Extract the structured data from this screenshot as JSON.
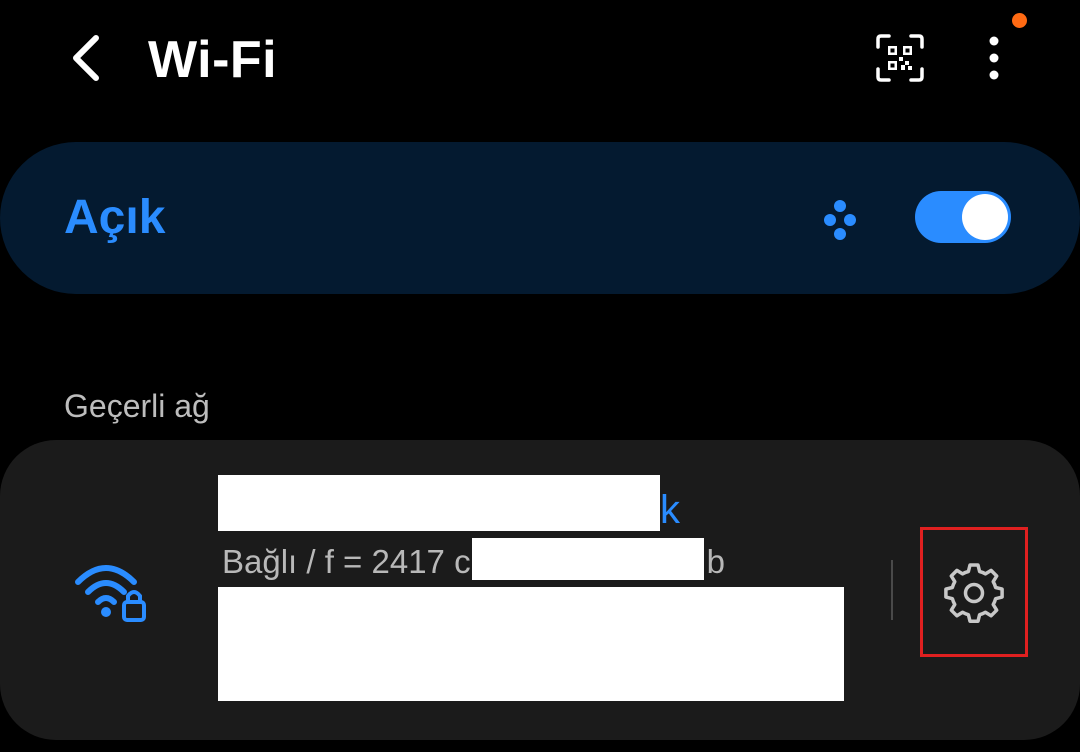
{
  "header": {
    "title": "Wi-Fi",
    "back_icon": "chevron-left-icon",
    "qr_icon": "qr-code-scan-icon",
    "more_icon": "more-vertical-icon",
    "notification_dot_color": "#ff6a13"
  },
  "toggle": {
    "label": "Açık",
    "state": true,
    "accent_color": "#2a8cff",
    "dots_icon": "wifi-direct-icon"
  },
  "current_network": {
    "section_title": "Geçerli ağ",
    "name_visible_suffix": "k",
    "status_text": "Bağlı / f = 2417 c",
    "status_suffix": "b",
    "icon": "wifi-lock-icon",
    "settings_icon": "gear-icon",
    "highlight_color": "#e02020"
  }
}
